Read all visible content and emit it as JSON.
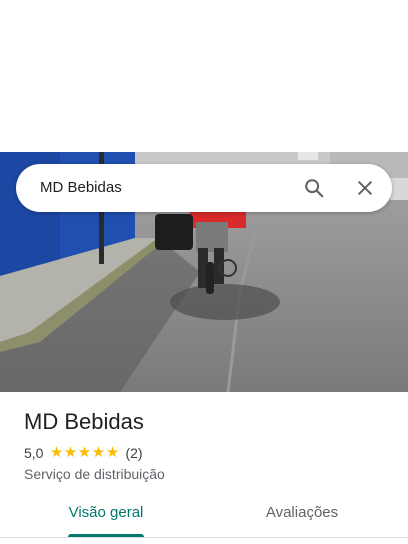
{
  "search": {
    "query": "MD Bebidas",
    "search_icon": "search-icon",
    "clear_icon": "close-icon"
  },
  "place": {
    "name": "MD Bebidas",
    "rating": "5,0",
    "stars": 5,
    "review_count": "(2)",
    "category": "Serviço de distribuição"
  },
  "tabs": [
    {
      "label": "Visão geral",
      "active": true
    },
    {
      "label": "Avaliações",
      "active": false
    }
  ],
  "colors": {
    "accent": "#00796b",
    "star": "#fbbc04",
    "text_primary": "#202124",
    "text_secondary": "#5f6368"
  }
}
